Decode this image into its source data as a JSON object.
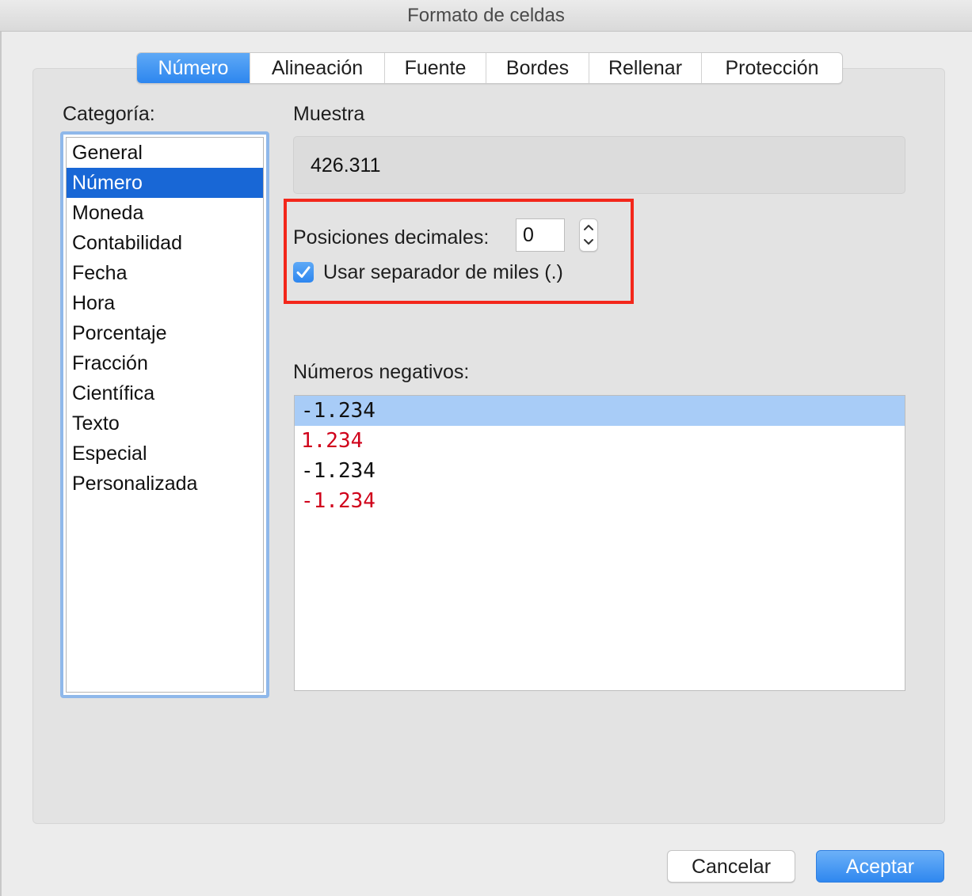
{
  "window": {
    "title": "Formato de celdas"
  },
  "tabs": [
    {
      "label": "Número",
      "active": true
    },
    {
      "label": "Alineación",
      "active": false
    },
    {
      "label": "Fuente",
      "active": false
    },
    {
      "label": "Bordes",
      "active": false
    },
    {
      "label": "Rellenar",
      "active": false
    },
    {
      "label": "Protección",
      "active": false
    }
  ],
  "category": {
    "label": "Categoría:",
    "items": [
      "General",
      "Número",
      "Moneda",
      "Contabilidad",
      "Fecha",
      "Hora",
      "Porcentaje",
      "Fracción",
      "Científica",
      "Texto",
      "Especial",
      "Personalizada"
    ],
    "selected": "Número"
  },
  "sample": {
    "label": "Muestra",
    "value": "426.311"
  },
  "decimals": {
    "label": "Posiciones decimales:",
    "value": "0"
  },
  "thousands_separator": {
    "label": "Usar separador de miles (.)",
    "checked": true
  },
  "negative_numbers": {
    "label": "Números negativos:",
    "items": [
      {
        "text": "-1.234",
        "color": "#111111",
        "selected": true
      },
      {
        "text": "1.234",
        "color": "#d0021b",
        "selected": false
      },
      {
        "text": "-1.234",
        "color": "#111111",
        "selected": false
      },
      {
        "text": "-1.234",
        "color": "#d0021b",
        "selected": false
      }
    ]
  },
  "buttons": {
    "cancel": "Cancelar",
    "ok": "Aceptar"
  },
  "colors": {
    "accent": "#2d86ef",
    "selection": "#1867d6",
    "highlight_annotation": "#f3271b",
    "negative_red": "#d0021b"
  }
}
